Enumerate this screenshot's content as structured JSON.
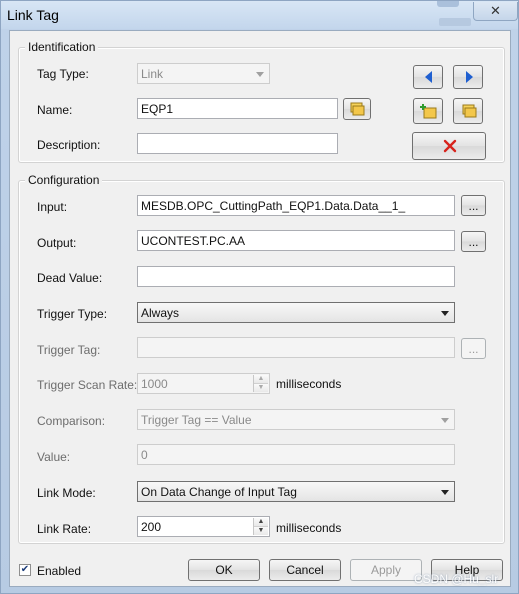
{
  "window": {
    "title": "Link Tag",
    "close_glyph": "✕",
    "colors": {
      "frame": "#bfd2e9",
      "client": "#f0f0f0",
      "delete_x": "#d7231c",
      "nav_arrow": "#1f5fd0"
    }
  },
  "identification": {
    "group_title": "Identification",
    "tag_type_label": "Tag Type:",
    "tag_type_value": "Link",
    "name_label": "Name:",
    "name_value": "EQP1",
    "description_label": "Description:",
    "description_value": "",
    "icons": [
      "arrow-left-icon",
      "arrow-right-icon",
      "new-tag-icon",
      "tag-browse-icon",
      "delete-icon"
    ]
  },
  "configuration": {
    "group_title": "Configuration",
    "input_label": "Input:",
    "input_value": "MESDB.OPC_CuttingPath_EQP1.Data.Data__1_",
    "output_label": "Output:",
    "output_value": "UCONTEST.PC.AA",
    "dead_value_label": "Dead Value:",
    "dead_value_value": "",
    "trigger_type_label": "Trigger Type:",
    "trigger_type_value": "Always",
    "trigger_tag_label": "Trigger Tag:",
    "trigger_tag_value": "",
    "trigger_scan_rate_label": "Trigger Scan Rate:",
    "trigger_scan_rate_value": "1000",
    "trigger_scan_rate_unit": "milliseconds",
    "comparison_label": "Comparison:",
    "comparison_value": "Trigger Tag == Value",
    "value_label": "Value:",
    "value_value": "0",
    "link_mode_label": "Link Mode:",
    "link_mode_value": "On Data Change of Input Tag",
    "link_rate_label": "Link Rate:",
    "link_rate_value": "200",
    "link_rate_unit": "milliseconds",
    "browse_label": "..."
  },
  "footer": {
    "enabled_label": "Enabled",
    "enabled_check": "✔",
    "ok_label": "OK",
    "cancel_label": "Cancel",
    "apply_label": "Apply",
    "help_label": "Help"
  },
  "watermark": "CSDN @Hu_slr"
}
